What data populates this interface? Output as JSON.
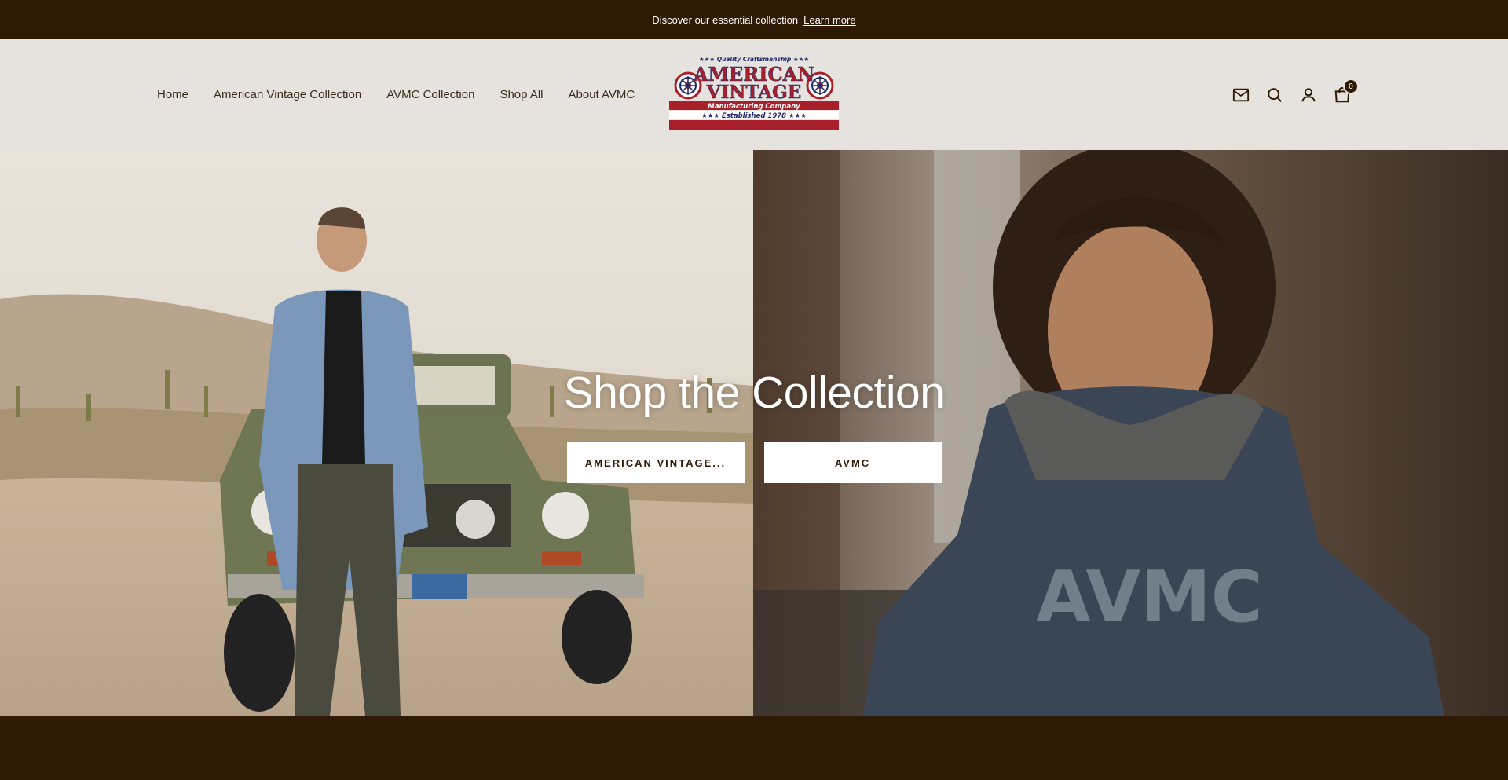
{
  "announcement": {
    "text": "Discover our essential collection",
    "link": "Learn more"
  },
  "nav": {
    "items": [
      {
        "label": "Home"
      },
      {
        "label": "American Vintage Collection"
      },
      {
        "label": "AVMC Collection"
      },
      {
        "label": "Shop All"
      },
      {
        "label": "About AVMC"
      }
    ]
  },
  "logo": {
    "top": "★★★ Quality Craftsmanship ★★★",
    "line1": "AMERICAN",
    "line2": "VINTAGE",
    "line3": "Manufacturing Company",
    "line4": "★★★ Established 1978 ★★★"
  },
  "header_icons": {
    "newsletter": "mail-icon",
    "search": "search-icon",
    "account": "account-icon",
    "cart": "cart-icon",
    "cart_count": "0"
  },
  "hero": {
    "title": "Shop the Collection",
    "button_left": "AMERICAN VINTAGE...",
    "button_right": "AVMC"
  },
  "colors": {
    "brand_dark": "#2e1a05",
    "header_bg": "#e6e2dd",
    "logo_red": "#a8202c",
    "logo_navy": "#1f2a6b"
  }
}
